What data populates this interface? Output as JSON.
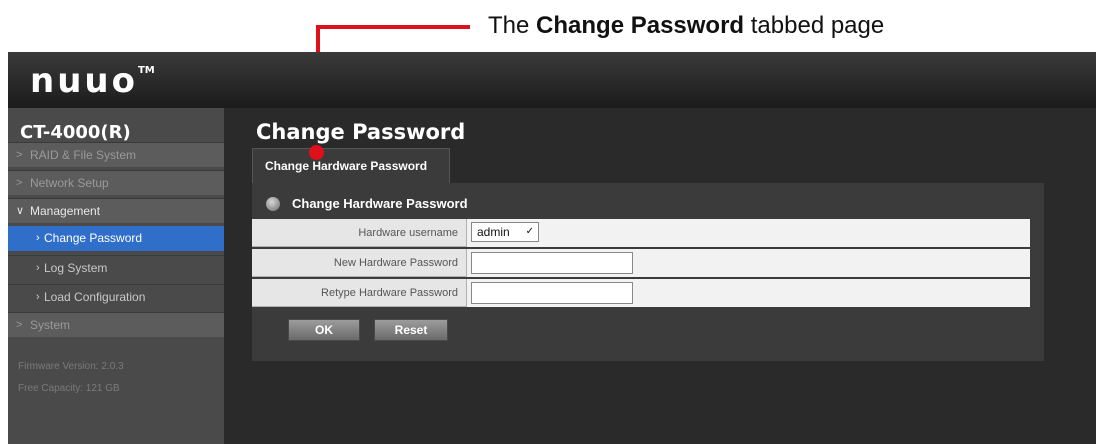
{
  "annotation": {
    "prefix": "The ",
    "bold": "Change Password",
    "suffix": " tabbed page"
  },
  "app": {
    "brand": "nuuo",
    "trademark": "TM",
    "device_name": "CT-4000(R)"
  },
  "sidebar": {
    "items": [
      {
        "label": "RAID & File System",
        "expanded": false
      },
      {
        "label": "Network Setup",
        "expanded": false
      },
      {
        "label": "Management",
        "expanded": true
      },
      {
        "label": "Change Password",
        "active": true
      },
      {
        "label": "Log System"
      },
      {
        "label": "Load Configuration"
      },
      {
        "label": "System",
        "expanded": false
      }
    ],
    "firmware": "Firmware Version: 2.0.3",
    "capacity": "Free Capacity: 121 GB"
  },
  "main": {
    "page_title": "Change Password",
    "tab_label": "Change Hardware Password",
    "section_title": "Change Hardware Password",
    "fields": {
      "username_label": "Hardware username",
      "username_value": "admin",
      "new_password_label": "New Hardware Password",
      "retype_password_label": "Retype Hardware Password"
    },
    "ok_label": "OK",
    "reset_label": "Reset"
  },
  "colors": {
    "callout_red": "#e0101a",
    "active_item_blue": "#2f6fc9"
  }
}
